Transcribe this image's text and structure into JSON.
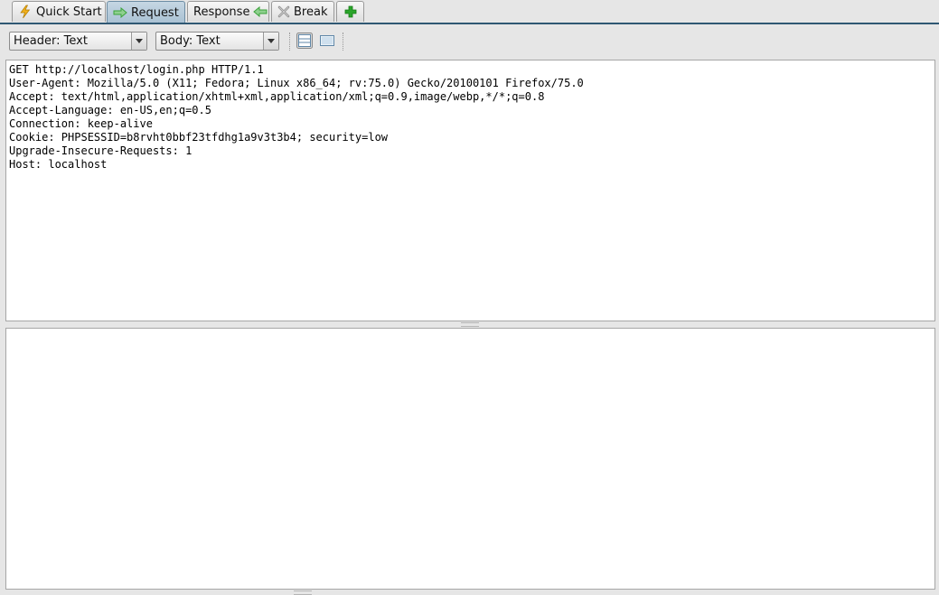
{
  "tabs": [
    {
      "label": "Quick Start",
      "icon": "lightning-icon",
      "selected": false
    },
    {
      "label": "Request",
      "icon": "arrow-right-icon",
      "selected": true
    },
    {
      "label": "Response",
      "icon": "arrow-left-icon",
      "selected": false
    },
    {
      "label": "Break",
      "icon": "cross-icon",
      "selected": false
    },
    {
      "label": "",
      "icon": "plus-icon",
      "selected": false
    }
  ],
  "toolbar": {
    "header_format": "Header: Text",
    "body_format": "Body: Text"
  },
  "request": {
    "text": "GET http://localhost/login.php HTTP/1.1\nUser-Agent: Mozilla/5.0 (X11; Fedora; Linux x86_64; rv:75.0) Gecko/20100101 Firefox/75.0\nAccept: text/html,application/xhtml+xml,application/xml;q=0.9,image/webp,*/*;q=0.8\nAccept-Language: en-US,en;q=0.5\nConnection: keep-alive\nCookie: PHPSESSID=b8rvht0bbf23tfdhg1a9v3t3b4; security=low\nUpgrade-Insecure-Requests: 1\nHost: localhost"
  },
  "colors": {
    "tab_underline": "#2f5873",
    "selected_tab": "#a9c1d3",
    "lightning": "#f2b11b",
    "arrow_green": "#3aa33a",
    "plus_green": "#2aa52a"
  }
}
